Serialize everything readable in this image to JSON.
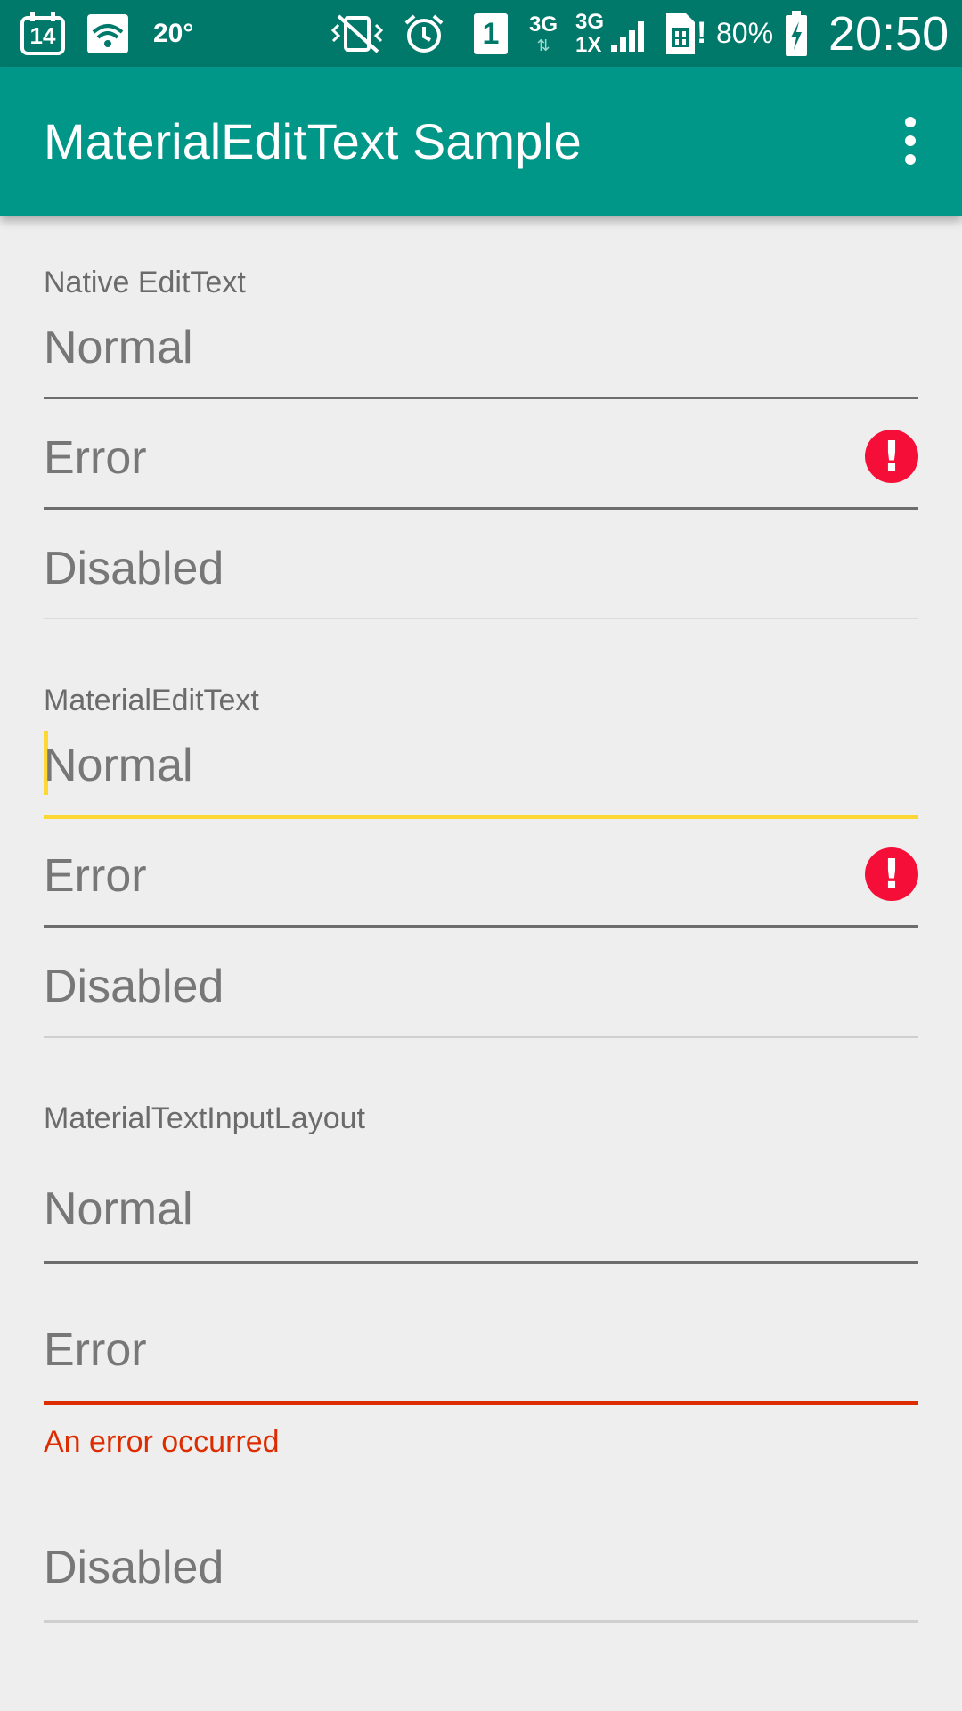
{
  "status_bar": {
    "date_badge": "14",
    "temperature": "20°",
    "sim_slot": "1",
    "network_1_top": "3G",
    "network_2_top": "3G",
    "network_2_bottom": "1X",
    "battery": "80%",
    "time": "20:50",
    "icons": [
      "calendar-icon",
      "wifi-icon",
      "weather-icon",
      "vibrate-icon",
      "alarm-icon",
      "sim-icon",
      "data-arrows-icon",
      "signal-icon",
      "sim-card-icon",
      "battery-charging-icon"
    ]
  },
  "app_bar": {
    "title": "MaterialEditText Sample",
    "menu_icon": "more-vert-icon"
  },
  "sections": {
    "native": {
      "heading": "Native EditText",
      "normal_hint": "Normal",
      "error_hint": "Error",
      "disabled_hint": "Disabled"
    },
    "material": {
      "heading": "MaterialEditText",
      "normal_hint": "Normal",
      "error_hint": "Error",
      "disabled_hint": "Disabled"
    },
    "layout": {
      "heading": "MaterialTextInputLayout",
      "normal_hint": "Normal",
      "error_hint": "Error",
      "error_message": "An error occurred",
      "disabled_hint": "Disabled"
    }
  },
  "colors": {
    "status_bar": "#00796b",
    "app_bar": "#009688",
    "background": "#eeeeee",
    "accent_focus": "#fdd835",
    "error_red": "#dd2c00",
    "error_icon": "#f50e37"
  }
}
